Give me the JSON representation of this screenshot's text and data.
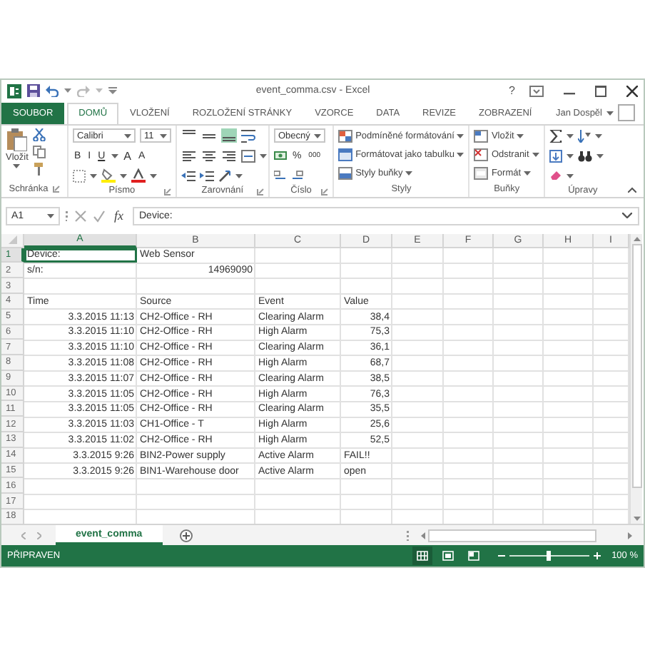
{
  "window": {
    "title": "event_comma.csv - Excel",
    "help": "?"
  },
  "ribbon_tabs": [
    {
      "label": "SOUBOR",
      "kind": "file",
      "selected": false
    },
    {
      "label": "DOMŮ",
      "kind": "tab",
      "selected": true
    },
    {
      "label": "VLOŽENÍ",
      "kind": "tab",
      "selected": false
    },
    {
      "label": "ROZLOŽENÍ STRÁNKY",
      "kind": "tab",
      "selected": false
    },
    {
      "label": "VZORCE",
      "kind": "tab",
      "selected": false
    },
    {
      "label": "DATA",
      "kind": "tab",
      "selected": false
    },
    {
      "label": "REVIZE",
      "kind": "tab",
      "selected": false
    },
    {
      "label": "ZOBRAZENÍ",
      "kind": "tab",
      "selected": false
    }
  ],
  "user": {
    "name": "Jan Dospěl"
  },
  "ribbon": {
    "clipboard": {
      "label": "Schránka",
      "paste": "Vložit"
    },
    "font": {
      "label": "Písmo",
      "font_name": "Calibri",
      "font_size": "11",
      "style_buttons": [
        "B",
        "I",
        "U"
      ],
      "size_buttons": [
        "A",
        "A"
      ]
    },
    "alignment": {
      "label": "Zarovnání",
      "vertical": [
        {
          "selected": false
        },
        {
          "selected": false
        },
        {
          "selected": true
        }
      ]
    },
    "number": {
      "label": "Číslo",
      "format": "Obecný",
      "buttons": [
        "%",
        "000"
      ]
    },
    "styles": {
      "label": "Styly",
      "items": [
        "Podmíněné formátování",
        "Formátovat jako tabulku",
        "Styly buňky"
      ]
    },
    "cells": {
      "label": "Buňky",
      "items": [
        "Vložit",
        "Odstranit",
        "Formát"
      ]
    },
    "editing": {
      "label": "Úpravy"
    }
  },
  "formula_bar": {
    "name_box": "A1",
    "fx": "fx",
    "value": "Device:"
  },
  "sheet": {
    "columns": [
      {
        "label": "A",
        "selected": true
      },
      {
        "label": "B",
        "selected": false
      },
      {
        "label": "C",
        "selected": false
      },
      {
        "label": "D",
        "selected": false
      },
      {
        "label": "E",
        "selected": false
      },
      {
        "label": "F",
        "selected": false
      },
      {
        "label": "G",
        "selected": false
      },
      {
        "label": "H",
        "selected": false
      },
      {
        "label": "I",
        "selected": false
      }
    ],
    "rows": [
      {
        "number": "1",
        "selected": true,
        "cells": [
          {
            "value": "Device:",
            "kind": "text"
          },
          {
            "value": "Web Sensor",
            "kind": "text"
          }
        ]
      },
      {
        "number": "2",
        "selected": false,
        "cells": [
          {
            "value": "s/n:",
            "kind": "text"
          },
          {
            "value": "14969090",
            "kind": "number"
          }
        ]
      },
      {
        "number": "3",
        "selected": false
      },
      {
        "number": "4",
        "selected": false,
        "cells": [
          {
            "value": "Time",
            "kind": "text"
          },
          {
            "value": "Source",
            "kind": "text"
          },
          {
            "value": "Event",
            "kind": "text"
          },
          {
            "value": "Value",
            "kind": "text"
          }
        ]
      },
      {
        "number": "5",
        "selected": false,
        "cells": [
          {
            "value": "3.3.2015 11:13",
            "kind": "number"
          },
          {
            "value": "CH2-Office - RH",
            "kind": "text"
          },
          {
            "value": "Clearing Alarm",
            "kind": "text"
          },
          {
            "value": "38,4",
            "kind": "number"
          }
        ]
      },
      {
        "number": "6",
        "selected": false,
        "cells": [
          {
            "value": "3.3.2015 11:10",
            "kind": "number"
          },
          {
            "value": "CH2-Office - RH",
            "kind": "text"
          },
          {
            "value": "High Alarm",
            "kind": "text"
          },
          {
            "value": "75,3",
            "kind": "number"
          }
        ]
      },
      {
        "number": "7",
        "selected": false,
        "cells": [
          {
            "value": "3.3.2015 11:10",
            "kind": "number"
          },
          {
            "value": "CH2-Office - RH",
            "kind": "text"
          },
          {
            "value": "Clearing Alarm",
            "kind": "text"
          },
          {
            "value": "36,1",
            "kind": "number"
          }
        ]
      },
      {
        "number": "8",
        "selected": false,
        "cells": [
          {
            "value": "3.3.2015 11:08",
            "kind": "number"
          },
          {
            "value": "CH2-Office - RH",
            "kind": "text"
          },
          {
            "value": "High Alarm",
            "kind": "text"
          },
          {
            "value": "68,7",
            "kind": "number"
          }
        ]
      },
      {
        "number": "9",
        "selected": false,
        "cells": [
          {
            "value": "3.3.2015 11:07",
            "kind": "number"
          },
          {
            "value": "CH2-Office - RH",
            "kind": "text"
          },
          {
            "value": "Clearing Alarm",
            "kind": "text"
          },
          {
            "value": "38,5",
            "kind": "number"
          }
        ]
      },
      {
        "number": "10",
        "selected": false,
        "cells": [
          {
            "value": "3.3.2015 11:05",
            "kind": "number"
          },
          {
            "value": "CH2-Office - RH",
            "kind": "text"
          },
          {
            "value": "High Alarm",
            "kind": "text"
          },
          {
            "value": "76,3",
            "kind": "number"
          }
        ]
      },
      {
        "number": "11",
        "selected": false,
        "cells": [
          {
            "value": "3.3.2015 11:05",
            "kind": "number"
          },
          {
            "value": "CH2-Office - RH",
            "kind": "text"
          },
          {
            "value": "Clearing Alarm",
            "kind": "text"
          },
          {
            "value": "35,5",
            "kind": "number"
          }
        ]
      },
      {
        "number": "12",
        "selected": false,
        "cells": [
          {
            "value": "3.3.2015 11:03",
            "kind": "number"
          },
          {
            "value": "CH1-Office - T",
            "kind": "text"
          },
          {
            "value": "High Alarm",
            "kind": "text"
          },
          {
            "value": "25,6",
            "kind": "number"
          }
        ]
      },
      {
        "number": "13",
        "selected": false,
        "cells": [
          {
            "value": "3.3.2015 11:02",
            "kind": "number"
          },
          {
            "value": "CH2-Office - RH",
            "kind": "text"
          },
          {
            "value": "High Alarm",
            "kind": "text"
          },
          {
            "value": "52,5",
            "kind": "number"
          }
        ]
      },
      {
        "number": "14",
        "selected": false,
        "cells": [
          {
            "value": "3.3.2015 9:26",
            "kind": "number"
          },
          {
            "value": "BIN2-Power supply",
            "kind": "text"
          },
          {
            "value": "Active Alarm",
            "kind": "text"
          },
          {
            "value": "FAIL!!",
            "kind": "text"
          }
        ]
      },
      {
        "number": "15",
        "selected": false,
        "cells": [
          {
            "value": "3.3.2015 9:26",
            "kind": "number"
          },
          {
            "value": "BIN1-Warehouse door",
            "kind": "text"
          },
          {
            "value": "Active Alarm",
            "kind": "text"
          },
          {
            "value": "open",
            "kind": "text"
          }
        ]
      },
      {
        "number": "16",
        "selected": false
      },
      {
        "number": "17",
        "selected": false
      },
      {
        "number": "18",
        "selected": false
      }
    ]
  },
  "sheet_tabs": [
    {
      "label": "event_comma",
      "selected": true
    }
  ],
  "status_bar": {
    "status": "PŘIPRAVEN",
    "views": [
      {
        "selected": true
      },
      {
        "selected": false
      },
      {
        "selected": false
      }
    ],
    "zoom": {
      "level": 0.5,
      "label": "100 %"
    }
  }
}
